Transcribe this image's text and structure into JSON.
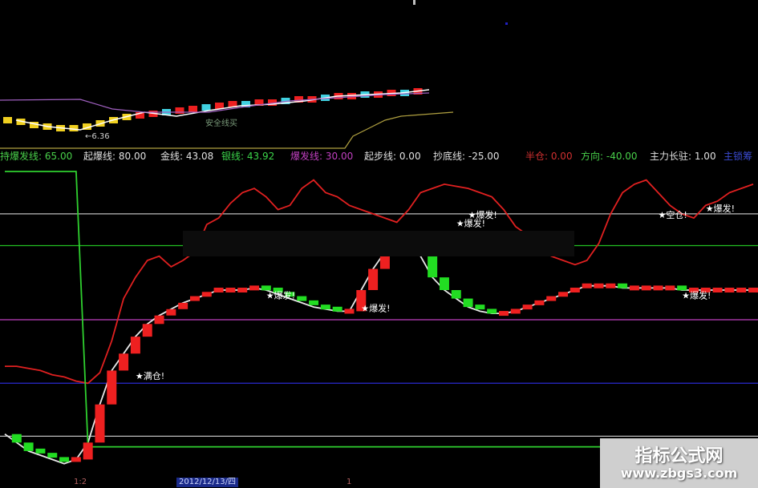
{
  "info_bar": {
    "items": [
      {
        "label": "持爆发线: 65.00",
        "color": "#49d04a"
      },
      {
        "label": "起爆线: 80.00",
        "color": "#e0e0e0"
      },
      {
        "label": "金线: 43.08",
        "color": "#e0e0e0"
      },
      {
        "label": "银线: 43.92",
        "color": "#3bd44a"
      },
      {
        "label": "爆发线: 30.00",
        "color": "#c040c0"
      },
      {
        "label": "起步线: 0.00",
        "color": "#e0e0e0"
      },
      {
        "label": "抄底线: -25.00",
        "color": "#e0e0e0"
      },
      {
        "label": "半仓: 0.00",
        "color": "#d03030"
      },
      {
        "label": "方向: -40.00",
        "color": "#49d04a"
      },
      {
        "label": "主力长驻: 1.00",
        "color": "#e0e0e0"
      },
      {
        "label": "主锁筹",
        "color": "#3a4ad0"
      }
    ]
  },
  "top_panel": {
    "annotations": [
      "←6.36",
      "安全线买"
    ]
  },
  "chart_data": {
    "type": "line",
    "ylim": [
      -40,
      100
    ],
    "levels": [
      {
        "value": 80,
        "color": "#bdbdbd"
      },
      {
        "value": 65,
        "color": "#22c022"
      },
      {
        "value": 30,
        "color": "#c040c0"
      },
      {
        "value": 0,
        "color": "#2a2ad0"
      },
      {
        "value": -25,
        "color": "#bdbdbd"
      }
    ],
    "x": [
      0,
      1,
      2,
      3,
      4,
      5,
      6,
      7,
      8,
      9,
      10,
      11,
      12,
      13,
      14,
      15,
      16,
      17,
      18,
      19,
      20,
      21,
      22,
      23,
      24,
      25,
      26,
      27,
      28,
      29,
      30,
      31,
      32,
      33,
      34,
      35,
      36,
      37,
      38,
      39,
      40,
      41,
      42,
      43,
      44,
      45,
      46,
      47,
      48,
      49,
      50,
      51,
      52,
      53,
      54,
      55,
      56,
      57,
      58,
      59,
      60,
      61,
      62,
      63
    ],
    "series": [
      {
        "color": "#e02020",
        "values": [
          8,
          8,
          7,
          6,
          4,
          3,
          1,
          0,
          5,
          20,
          40,
          50,
          58,
          60,
          55,
          58,
          62,
          75,
          78,
          85,
          90,
          92,
          88,
          82,
          84,
          92,
          96,
          90,
          88,
          84,
          82,
          80,
          78,
          76,
          82,
          90,
          92,
          94,
          93,
          92,
          90,
          88,
          82,
          74,
          70,
          65,
          60,
          58,
          56,
          58,
          66,
          80,
          90,
          94,
          96,
          90,
          84,
          80,
          78,
          84,
          86,
          90,
          92,
          94
        ]
      },
      {
        "color": "#e8e8e8",
        "values": [
          -24,
          -28,
          -32,
          -34,
          -36,
          -38,
          -36,
          -28,
          -10,
          6,
          14,
          22,
          28,
          32,
          35,
          38,
          40,
          42,
          44,
          44,
          44,
          45,
          44,
          42,
          40,
          38,
          36,
          35,
          34,
          34,
          44,
          54,
          62,
          65,
          64,
          60,
          50,
          44,
          40,
          36,
          34,
          33,
          33,
          34,
          36,
          38,
          40,
          42,
          44,
          46,
          46,
          46,
          45,
          45,
          45,
          45,
          45,
          44,
          44,
          44,
          44,
          44,
          44,
          44
        ]
      },
      {
        "color": "#2fd02f",
        "values": [
          100,
          100,
          100,
          100,
          100,
          100,
          100,
          -30,
          -30,
          -30,
          -30,
          -30,
          -30,
          -30,
          -30,
          -30,
          -30,
          -30,
          -30,
          -30,
          -30,
          -30,
          -30,
          -30,
          -30,
          -30,
          -30,
          -30,
          -30,
          -30,
          -30,
          -30,
          -30,
          -30,
          -30,
          -30,
          -30,
          -30,
          -30,
          -30,
          -30,
          -30,
          -30,
          -30,
          -30,
          -30,
          -30,
          -30,
          -30,
          -30,
          -30,
          -30,
          -30,
          -30,
          -30,
          -30,
          -30,
          -30,
          -30,
          -30,
          -30,
          -30,
          -30,
          -30
        ]
      }
    ],
    "labels": [
      "★爆发!",
      "★爆发!",
      "★满仓!",
      "★爆发!",
      "★爆发!",
      "★空仓!",
      "★爆发!",
      "★爆发!"
    ],
    "label_points": [
      [
        22,
        40
      ],
      [
        38,
        74
      ],
      [
        11,
        2
      ],
      [
        30,
        34
      ],
      [
        39,
        78
      ],
      [
        55,
        78
      ],
      [
        57,
        40
      ],
      [
        59,
        81
      ]
    ]
  },
  "bottom_axis": {
    "tick_a": "1:2",
    "date_label": "2012/12/13/四",
    "tick_b": "1"
  },
  "watermark": {
    "title": "指标公式网",
    "url": "www.zbgs3.com"
  }
}
